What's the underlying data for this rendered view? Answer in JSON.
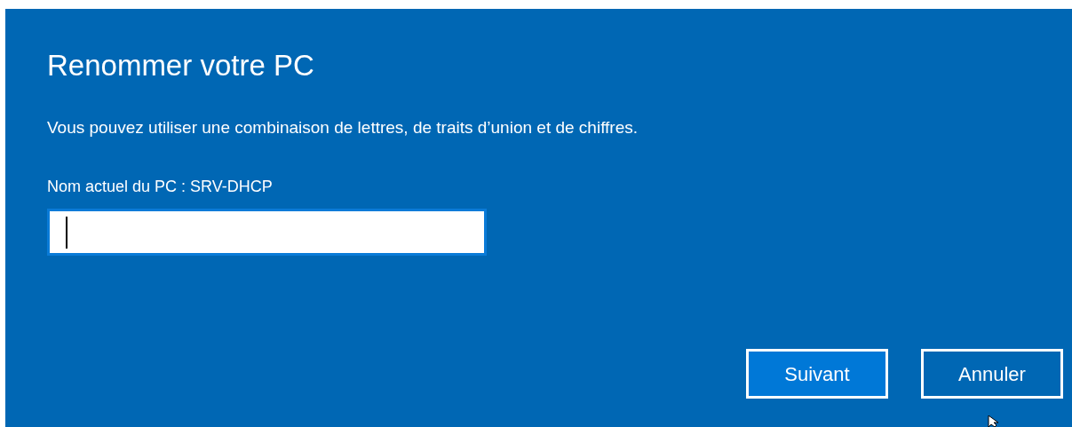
{
  "dialog": {
    "title": "Renommer votre PC",
    "description": "Vous pouvez utiliser une combinaison de lettres, de traits d’union et de chiffres.",
    "current_name": "Nom actuel du PC : SRV-DHCP",
    "name_field": {
      "focused": true
    },
    "buttons": [
      {
        "label": "Suivant",
        "default": true
      },
      {
        "label": "Annuler",
        "default": false
      }
    ]
  }
}
